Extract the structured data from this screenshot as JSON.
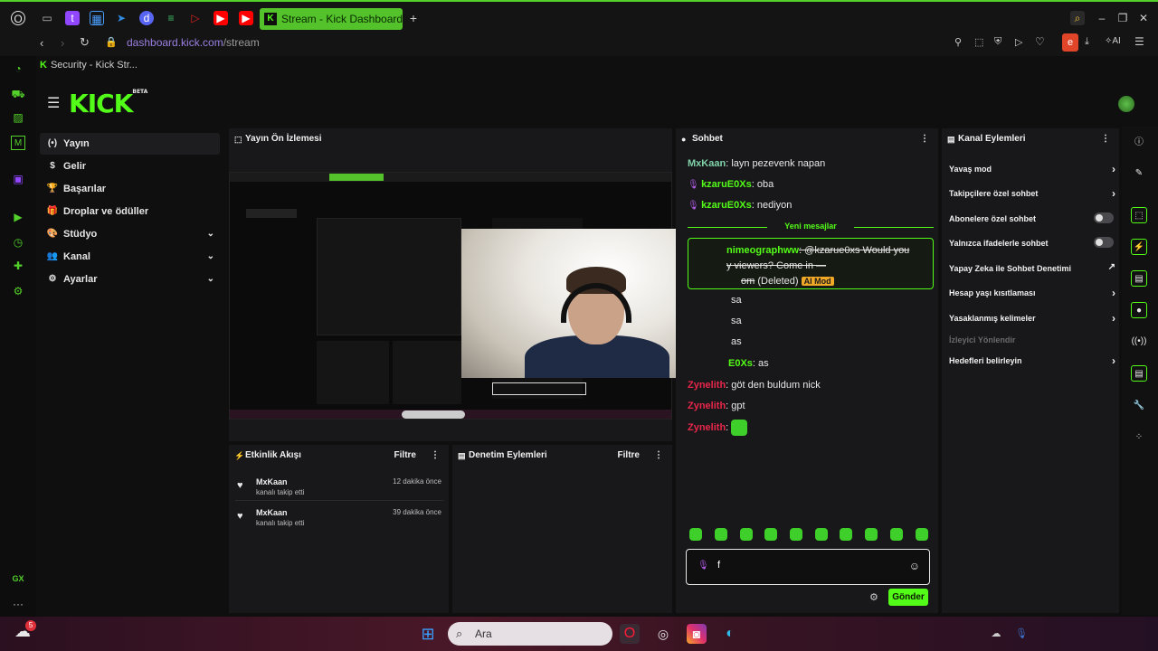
{
  "browser": {
    "active_tab_title": "Stream - Kick Dashboard",
    "active_tab_logo": "K",
    "url_host": "dashboard.kick.com",
    "url_path": "/stream",
    "bookmark_title": "Security - Kick Str...",
    "ai_label": "AI",
    "ext_label": "e",
    "gx_label": "GX"
  },
  "kick": {
    "logo": "KICK",
    "logo_badge": "BETA"
  },
  "nav": {
    "items": [
      {
        "label": "Yayın",
        "icon": "broadcast-icon",
        "glyph": "(•)"
      },
      {
        "label": "Gelir",
        "icon": "dollar-icon",
        "glyph": "$"
      },
      {
        "label": "Başarılar",
        "icon": "trophy-icon",
        "glyph": "🏆"
      },
      {
        "label": "Droplar ve ödüller",
        "icon": "gift-icon",
        "glyph": "🎁"
      },
      {
        "label": "Stüdyo",
        "icon": "palette-icon",
        "glyph": "🎨"
      },
      {
        "label": "Kanal",
        "icon": "people-icon",
        "glyph": "👥"
      },
      {
        "label": "Ayarlar",
        "icon": "gear-icon",
        "glyph": "⚙"
      }
    ]
  },
  "preview": {
    "title": "Yayın Ön İzlemesi"
  },
  "activity": {
    "title": "Etkinlik Akışı",
    "filter": "Filtre",
    "events": [
      {
        "user": "MxKaan",
        "action": "kanalı takip etti",
        "time": "12 dakika önce"
      },
      {
        "user": "MxKaan",
        "action": "kanalı takip etti",
        "time": "39 dakika önce"
      }
    ]
  },
  "moderation": {
    "title": "Denetim Eylemleri",
    "filter": "Filtre"
  },
  "chat": {
    "title": "Sohbet",
    "messages_top": [
      {
        "user": "MxKaan",
        "text": "layn pezevenk napan",
        "color": "#7fd1a8",
        "mic": false
      },
      {
        "user": "kzaruE0Xs",
        "text": "oba",
        "color": "#53fc18",
        "mic": true
      },
      {
        "user": "kzaruE0Xs",
        "text": "nediyon",
        "color": "#53fc18",
        "mic": true
      }
    ],
    "new_messages": "Yeni mesajlar",
    "pinned": {
      "user": "nimeographww",
      "line1": ": @kzarue0xs Would you",
      "line2": "y viewers? Come in —",
      "line3": "om",
      "deleted": "(Deleted)",
      "badge": "AI Mod"
    },
    "messages_bottom": [
      {
        "user": "",
        "text": "sa",
        "color": "#53fc18"
      },
      {
        "user": "",
        "text": "sa",
        "color": "#53fc18"
      },
      {
        "user": "",
        "text": "as",
        "color": "#53fc18"
      },
      {
        "user": "E0Xs",
        "text": "as",
        "color": "#53fc18"
      },
      {
        "user": "Zynelith",
        "text": "göt den buldum nick",
        "color": "#e8264a"
      },
      {
        "user": "Zynelith",
        "text": "gpt",
        "color": "#e8264a"
      },
      {
        "user": "Zynelith",
        "text": "",
        "color": "#e8264a",
        "emote": true
      }
    ],
    "input_value": "f",
    "send_label": "Gönder"
  },
  "channel_actions": {
    "title": "Kanal Eylemleri",
    "items": [
      {
        "label": "Yavaş mod",
        "control": "chevron"
      },
      {
        "label": "Takipçilere özel sohbet",
        "control": "chevron"
      },
      {
        "label": "Abonelere özel sohbet",
        "control": "toggle"
      },
      {
        "label": "Yalnızca ifadelerle sohbet",
        "control": "toggle"
      },
      {
        "label": "Yapay Zeka ile Sohbet Denetimi",
        "control": "external"
      },
      {
        "label": "Hesap yaşı kısıtlaması",
        "control": "chevron"
      },
      {
        "label": "Yasaklanmış kelimeler",
        "control": "chevron"
      },
      {
        "label": "İzleyici Yönlendir",
        "control": "none",
        "disabled": true
      },
      {
        "label": "Hedefleri belirleyin",
        "control": "chevron"
      }
    ]
  },
  "taskbar": {
    "search_placeholder": "Ara",
    "notification_count": "5"
  },
  "colors": {
    "kick_green": "#53fc18",
    "panel": "#18181a",
    "background": "#0f0f10"
  }
}
